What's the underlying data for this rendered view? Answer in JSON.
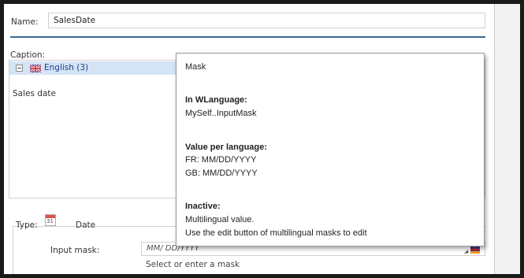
{
  "form": {
    "name_label": "Name:",
    "name_value": "SalesDate",
    "caption_label": "Caption:",
    "language_item": "English (3)",
    "caption_value": "Sales date",
    "type_label": "Type:",
    "type_icon_text": "31",
    "type_value": "Date",
    "input_mask_label": "Input mask:",
    "input_mask_value": "MM/ DD/YYYY",
    "input_mask_hint": "Select or enter a mask"
  },
  "tooltip": {
    "title": "Mask",
    "wlanguage_heading": "In WLanguage:",
    "wlanguage_value": "MySelf..InputMask",
    "value_per_language_heading": "Value per language:",
    "value_fr": "FR: MM/DD/YYYY",
    "value_gb": "GB: MM/DD/YYYY",
    "inactive_heading": "Inactive:",
    "inactive_line1": "Multilingual value.",
    "inactive_line2": "Use the edit button of multilingual masks to edit"
  },
  "colors": {
    "accent_rule": "#3a6b96",
    "selected_row": "#d5e4f5",
    "language_text": "#1a3f8f"
  },
  "icons": {
    "tree_toggle": "minus-icon",
    "language_flag": "uk-flag-icon",
    "type": "calendar-icon",
    "mask_edit": "edit-multilingual-icon"
  }
}
